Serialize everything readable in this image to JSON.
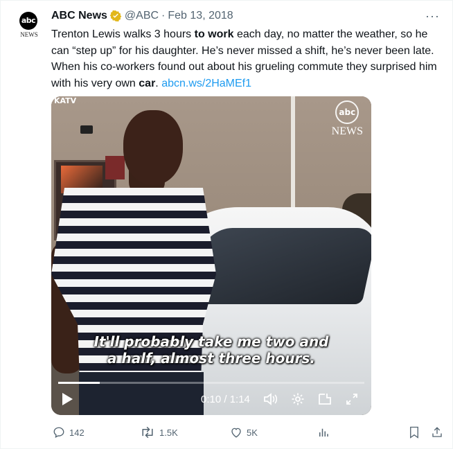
{
  "tweet": {
    "author": {
      "name": "ABC News",
      "handle": "@ABC",
      "date": "Feb 13, 2018",
      "avatar_top": "abc",
      "avatar_bottom": "NEWS"
    },
    "more_label": "···",
    "text_parts": [
      "Trenton Lewis walks 3 hours ",
      "to work",
      " each day, no matter the weather, so he can “step up” for his daughter. He’s never missed a shift, he’s never been late. When his co-workers found out about his grueling commute they surprised him with his very own ",
      "car",
      ". ",
      "abcn.ws/2HaMEf1"
    ]
  },
  "video": {
    "watermark_left": "KATV",
    "watermark_right_logo": "abc",
    "watermark_right_text": "NEWS",
    "caption_line1": "It'll probably take me two and",
    "caption_line2": "a half, almost three hours.",
    "time": "0:10 / 1:14",
    "progress": 0.135
  },
  "metrics": {
    "replies": "142",
    "reposts": "1.5K",
    "likes": "5K"
  },
  "colors": {
    "link": "#1d9bf0",
    "muted": "#536471",
    "verified": "#e2b719"
  }
}
